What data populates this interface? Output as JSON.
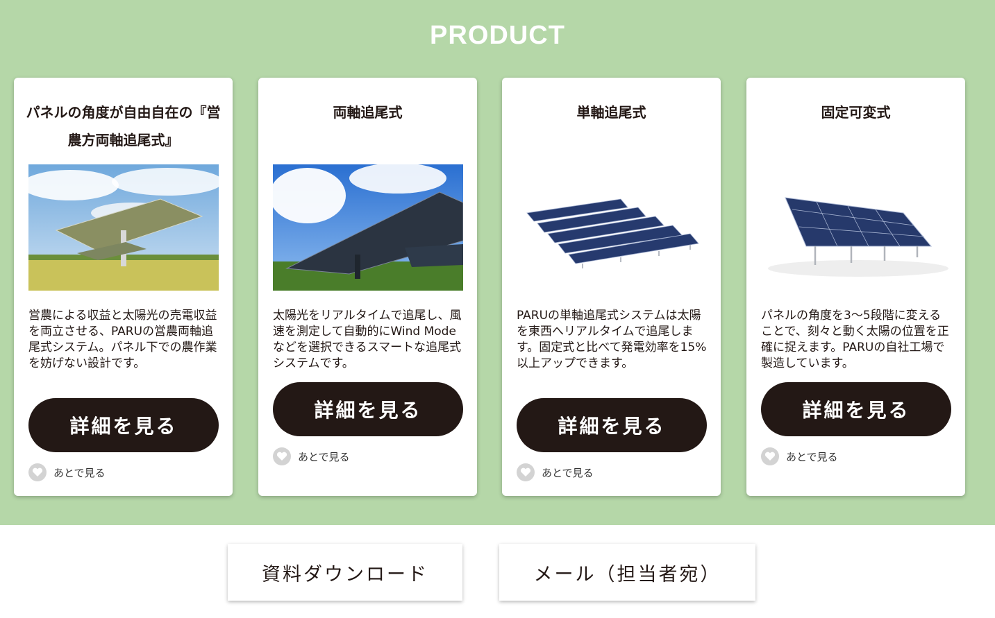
{
  "section": {
    "title": "PRODUCT",
    "background": "#b5d7a8"
  },
  "cards": [
    {
      "title": "パネルの角度が自由自在の『営農方両軸追尾式』",
      "description": "営農による収益と太陽光の売電収益を両立させる、PARUの営農両軸追尾式システム。パネル下での農作業を妨げない設計です。",
      "button_label": "詳細を見る",
      "later_label": "あとで見る",
      "image_icon": "agri-dual-axis-solar-photo"
    },
    {
      "title": "両軸追尾式",
      "description": "太陽光をリアルタイムで追尾し、風速を測定して自動的にWind Modeなどを選択できるスマートな追尾式システムです。",
      "button_label": "詳細を見る",
      "later_label": "あとで見る",
      "image_icon": "dual-axis-solar-photo"
    },
    {
      "title": "単軸追尾式",
      "description": "PARUの単軸追尾式システムは太陽を東西へリアルタイムで追尾します。固定式と比べて発電効率を15%以上アップできます。",
      "button_label": "詳細を見る",
      "later_label": "あとで見る",
      "image_icon": "single-axis-solar-photo"
    },
    {
      "title": "固定可変式",
      "description": "パネルの角度を3〜5段階に変えることで、刻々と動く太陽の位置を正確に捉えます。PARUの自社工場で製造しています。",
      "button_label": "詳細を見る",
      "later_label": "あとで見る",
      "image_icon": "fixed-variable-solar-photo"
    }
  ],
  "footer_buttons": {
    "download": "資料ダウンロード",
    "mail": "メール（担当者宛）"
  },
  "colors": {
    "button": "#231815",
    "heart": "#d3d3d3",
    "text": "#231815"
  }
}
